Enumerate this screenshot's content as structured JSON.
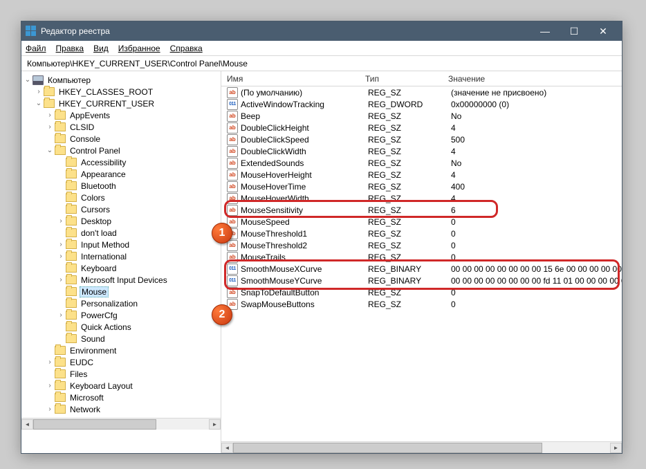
{
  "title": "Редактор реестра",
  "menu": {
    "file": "Файл",
    "edit": "Правка",
    "view": "Вид",
    "fav": "Избранное",
    "help": "Справка"
  },
  "address": "Компьютер\\HKEY_CURRENT_USER\\Control Panel\\Mouse",
  "cols": {
    "name": "Имя",
    "type": "Тип",
    "value": "Значение"
  },
  "tree": {
    "root": "Компьютер",
    "hkcr": "HKEY_CLASSES_ROOT",
    "hkcu": "HKEY_CURRENT_USER",
    "appevents": "AppEvents",
    "clsid": "CLSID",
    "console": "Console",
    "cpanel": "Control Panel",
    "access": "Accessibility",
    "appear": "Appearance",
    "bt": "Bluetooth",
    "colors": "Colors",
    "cursors": "Cursors",
    "desk": "Desktop",
    "dontload": "don't load",
    "input": "Input Method",
    "intl": "International",
    "kbd": "Keyboard",
    "midev": "Microsoft Input Devices",
    "mouse": "Mouse",
    "pers": "Personalization",
    "pcfg": "PowerCfg",
    "qact": "Quick Actions",
    "sound": "Sound",
    "env": "Environment",
    "eudc": "EUDC",
    "files": "Files",
    "kblay": "Keyboard Layout",
    "ms": "Microsoft",
    "net": "Network"
  },
  "rows": [
    {
      "ic": "str",
      "n": "(По умолчанию)",
      "t": "REG_SZ",
      "v": "(значение не присвоено)"
    },
    {
      "ic": "bin",
      "n": "ActiveWindowTracking",
      "t": "REG_DWORD",
      "v": "0x00000000 (0)"
    },
    {
      "ic": "str",
      "n": "Beep",
      "t": "REG_SZ",
      "v": "No"
    },
    {
      "ic": "str",
      "n": "DoubleClickHeight",
      "t": "REG_SZ",
      "v": "4"
    },
    {
      "ic": "str",
      "n": "DoubleClickSpeed",
      "t": "REG_SZ",
      "v": "500"
    },
    {
      "ic": "str",
      "n": "DoubleClickWidth",
      "t": "REG_SZ",
      "v": "4"
    },
    {
      "ic": "str",
      "n": "ExtendedSounds",
      "t": "REG_SZ",
      "v": "No"
    },
    {
      "ic": "str",
      "n": "MouseHoverHeight",
      "t": "REG_SZ",
      "v": "4"
    },
    {
      "ic": "str",
      "n": "MouseHoverTime",
      "t": "REG_SZ",
      "v": "400"
    },
    {
      "ic": "str",
      "n": "MouseHoverWidth",
      "t": "REG_SZ",
      "v": "4"
    },
    {
      "ic": "str",
      "n": "MouseSensitivity",
      "t": "REG_SZ",
      "v": "6"
    },
    {
      "ic": "str",
      "n": "MouseSpeed",
      "t": "REG_SZ",
      "v": "0"
    },
    {
      "ic": "str",
      "n": "MouseThreshold1",
      "t": "REG_SZ",
      "v": "0"
    },
    {
      "ic": "str",
      "n": "MouseThreshold2",
      "t": "REG_SZ",
      "v": "0"
    },
    {
      "ic": "str",
      "n": "MouseTrails",
      "t": "REG_SZ",
      "v": "0"
    },
    {
      "ic": "bin",
      "n": "SmoothMouseXCurve",
      "t": "REG_BINARY",
      "v": "00 00 00 00 00 00 00 00 15 6e 00 00 00 00 00 00 0"
    },
    {
      "ic": "bin",
      "n": "SmoothMouseYCurve",
      "t": "REG_BINARY",
      "v": "00 00 00 00 00 00 00 00 fd 11 01 00 00 00 00 00 0"
    },
    {
      "ic": "str",
      "n": "SnapToDefaultButton",
      "t": "REG_SZ",
      "v": "0"
    },
    {
      "ic": "str",
      "n": "SwapMouseButtons",
      "t": "REG_SZ",
      "v": "0"
    }
  ],
  "badges": {
    "b1": "1",
    "b2": "2"
  }
}
